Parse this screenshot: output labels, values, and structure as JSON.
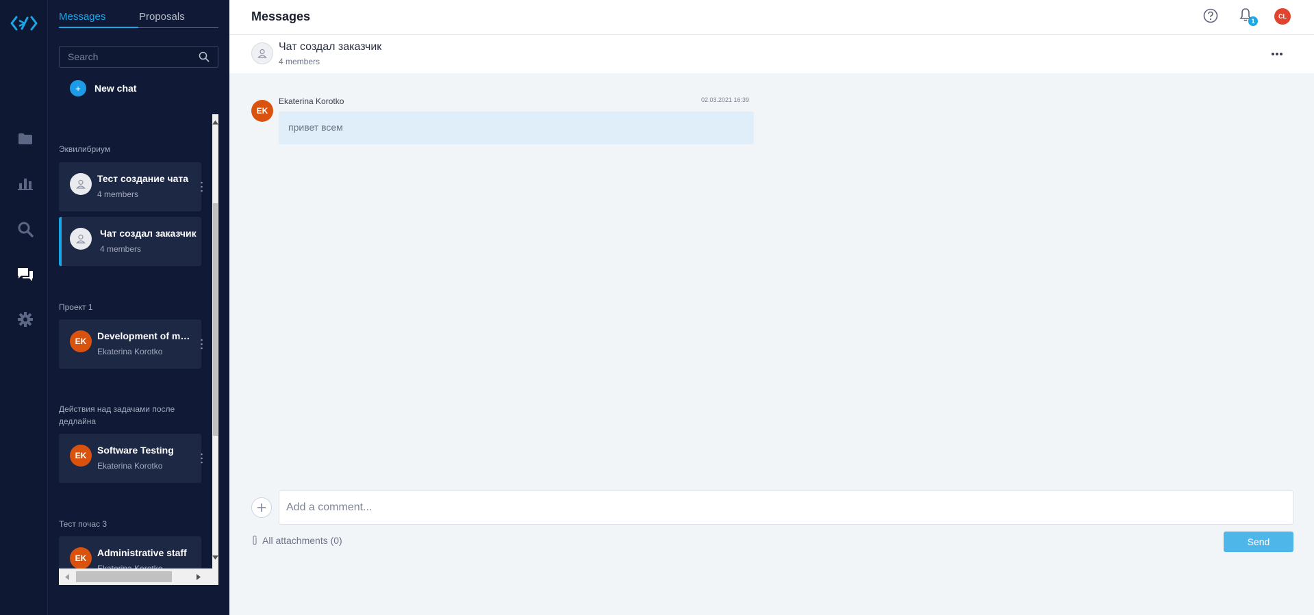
{
  "rail": {
    "items": [
      {
        "icon": "folder-icon"
      },
      {
        "icon": "bar-chart-icon"
      },
      {
        "icon": "search-icon"
      },
      {
        "icon": "chat-icon",
        "active": true
      },
      {
        "icon": "gear-icon"
      }
    ]
  },
  "panel": {
    "tabs": {
      "messages": "Messages",
      "proposals": "Proposals"
    },
    "search_placeholder": "Search",
    "new_chat": "New chat",
    "plus_glyph": "+",
    "groups": [
      {
        "title": "Эквилибриум",
        "chats": [
          {
            "name": "Тест создание чата",
            "sub": "4 members",
            "avatar": "",
            "active": false
          },
          {
            "name": "Чат создал заказчик",
            "sub": "4 members",
            "avatar": "",
            "active": true
          }
        ]
      },
      {
        "title": "Проект 1",
        "chats": [
          {
            "name": "Development of mobile app",
            "sub": "Ekaterina Korotko",
            "avatar": "EK"
          }
        ]
      },
      {
        "title": "Действия над задачами после дедлайна",
        "chats": [
          {
            "name": "Software Testing",
            "sub": "Ekaterina Korotko",
            "avatar": "EK"
          }
        ]
      },
      {
        "title": "Тест почас 3",
        "chats": [
          {
            "name": "Administrative staff",
            "sub": "Ekaterina Korotko",
            "avatar": "EK"
          }
        ]
      }
    ]
  },
  "header": {
    "title": "Messages",
    "notifications_count": "1",
    "user_initials": "CL"
  },
  "chat": {
    "name": "Чат создал заказчик",
    "members": "4 members",
    "messages": [
      {
        "author": "Ekaterina Korotko",
        "initials": "EK",
        "time": "02.03.2021 16:39",
        "text": "привет всем"
      }
    ]
  },
  "composer": {
    "placeholder": "Add a comment...",
    "attachments": "All attachments (0)",
    "send": "Send"
  },
  "colors": {
    "rail_bg": "#0f1832",
    "panel_bg": "#101a37",
    "card_bg": "#1d2845",
    "accent": "#19a7e6",
    "avatar_orange": "#d9530f",
    "send_button": "#4fb6ea",
    "main_bg": "#f2f5f8"
  }
}
